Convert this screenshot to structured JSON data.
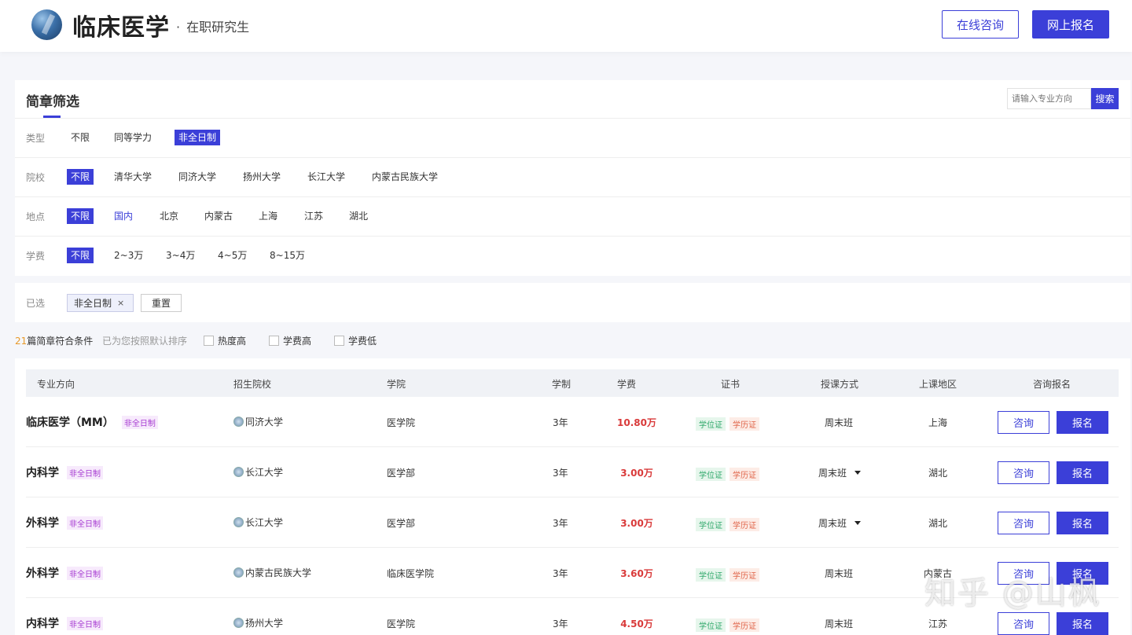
{
  "header": {
    "title": "临床医学",
    "subtitle_dot": "·",
    "subtitle": "在职研究生",
    "consult_label": "在线咨询",
    "apply_label": "网上报名"
  },
  "filter": {
    "title": "简章筛选",
    "search_placeholder": "请输入专业方向",
    "search_label": "搜索",
    "rows": [
      {
        "label": "类型",
        "options": [
          "不限",
          "同等学力",
          "非全日制"
        ],
        "active": "非全日制"
      },
      {
        "label": "院校",
        "options": [
          "不限",
          "清华大学",
          "同济大学",
          "扬州大学",
          "长江大学",
          "内蒙古民族大学"
        ],
        "active": "不限"
      },
      {
        "label": "地点",
        "options": [
          "不限",
          "国内",
          "北京",
          "内蒙古",
          "上海",
          "江苏",
          "湖北"
        ],
        "active": "不限",
        "highlight": "国内"
      },
      {
        "label": "学费",
        "options": [
          "不限",
          "2~3万",
          "3~4万",
          "4~5万",
          "8~15万"
        ],
        "active": "不限"
      }
    ]
  },
  "selected": {
    "label": "已选",
    "tag": "非全日制",
    "tag_close": "×",
    "reset_label": "重置"
  },
  "sortbar": {
    "count": "21",
    "count_text": "篇简章符合条件",
    "hint": "已为您按照默认排序",
    "options": [
      "热度高",
      "学费高",
      "学费低"
    ]
  },
  "table": {
    "headers": [
      "专业方向",
      "招生院校",
      "学院",
      "学制",
      "学费",
      "证书",
      "授课方式",
      "上课地区",
      "咨询报名"
    ],
    "rows": [
      {
        "major": "临床医学（MM）",
        "type": "非全日制",
        "school": "同济大学",
        "college": "医学院",
        "duration": "3年",
        "fee": "10.80万",
        "cert_degree": "学位证",
        "cert_edu": "学历证",
        "mode": "周末班",
        "mode_dropdown": false,
        "region": "上海",
        "consult": "咨询",
        "apply": "报名"
      },
      {
        "major": "内科学",
        "type": "非全日制",
        "school": "长江大学",
        "college": "医学部",
        "duration": "3年",
        "fee": "3.00万",
        "cert_degree": "学位证",
        "cert_edu": "学历证",
        "mode": "周末班",
        "mode_dropdown": true,
        "region": "湖北",
        "consult": "咨询",
        "apply": "报名"
      },
      {
        "major": "外科学",
        "type": "非全日制",
        "school": "长江大学",
        "college": "医学部",
        "duration": "3年",
        "fee": "3.00万",
        "cert_degree": "学位证",
        "cert_edu": "学历证",
        "mode": "周末班",
        "mode_dropdown": true,
        "region": "湖北",
        "consult": "咨询",
        "apply": "报名"
      },
      {
        "major": "外科学",
        "type": "非全日制",
        "school": "内蒙古民族大学",
        "college": "临床医学院",
        "duration": "3年",
        "fee": "3.60万",
        "cert_degree": "学位证",
        "cert_edu": "学历证",
        "mode": "周末班",
        "mode_dropdown": false,
        "region": "内蒙古",
        "consult": "咨询",
        "apply": "报名"
      },
      {
        "major": "内科学",
        "type": "非全日制",
        "school": "扬州大学",
        "college": "医学院",
        "duration": "3年",
        "fee": "4.50万",
        "cert_degree": "学位证",
        "cert_edu": "学历证",
        "mode": "周末班",
        "mode_dropdown": false,
        "region": "江苏",
        "consult": "咨询",
        "apply": "报名"
      }
    ]
  },
  "watermark": "知乎 @山枫",
  "colors": {
    "accent": "#3b3fd8",
    "fee": "#d93a3a",
    "count": "#e89a2b"
  }
}
